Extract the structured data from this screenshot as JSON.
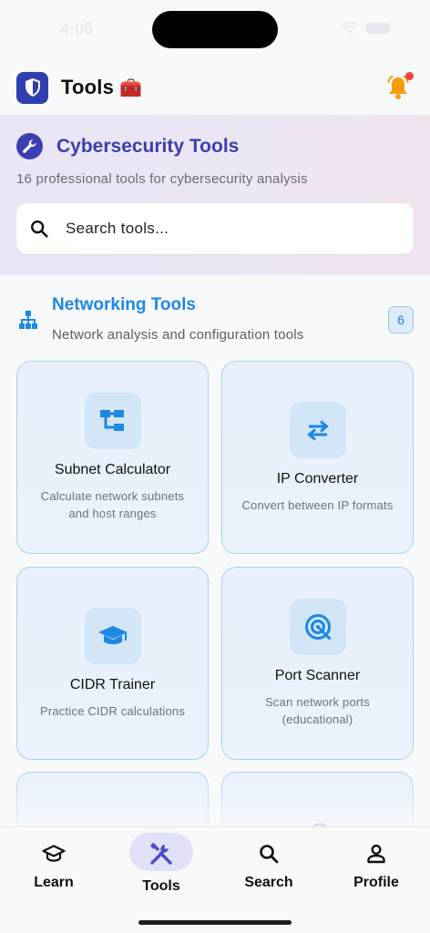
{
  "status_bar": {
    "time": "4:05"
  },
  "header": {
    "title": "Tools",
    "emoji": "🧰",
    "logo_icon": "shield-icon",
    "notification_icon": "bell-icon",
    "colors": {
      "logo": "#2f3fb0",
      "bell": "#f59e0b",
      "dot": "#ef4444"
    }
  },
  "hero": {
    "title": "Cybersecurity Tools",
    "subtitle": "16 professional tools for cybersecurity analysis",
    "icon": "wrench-icon",
    "search": {
      "placeholder": "Search tools...",
      "value": ""
    }
  },
  "section": {
    "title": "Networking Tools",
    "subtitle": "Network analysis and configuration tools",
    "count": "6",
    "icon": "network-icon"
  },
  "tools": [
    {
      "name": "Subnet Calculator",
      "description": "Calculate network subnets and host ranges",
      "icon": "subnet-icon"
    },
    {
      "name": "IP Converter",
      "description": "Convert between IP formats",
      "icon": "swap-arrows-icon"
    },
    {
      "name": "CIDR Trainer",
      "description": "Practice CIDR calculations",
      "icon": "graduation-cap-icon"
    },
    {
      "name": "Port Scanner",
      "description": "Scan network ports (educational)",
      "icon": "radar-icon"
    }
  ],
  "tabs": [
    {
      "label": "Learn",
      "icon": "graduation-cap-icon",
      "active": false
    },
    {
      "label": "Tools",
      "icon": "tools-icon",
      "active": true
    },
    {
      "label": "Search",
      "icon": "search-icon",
      "active": false
    },
    {
      "label": "Profile",
      "icon": "person-icon",
      "active": false
    }
  ],
  "colors": {
    "accent": "#1e88e5",
    "hero_title": "#3b3fae",
    "active_tab": "#4b4fc4"
  }
}
